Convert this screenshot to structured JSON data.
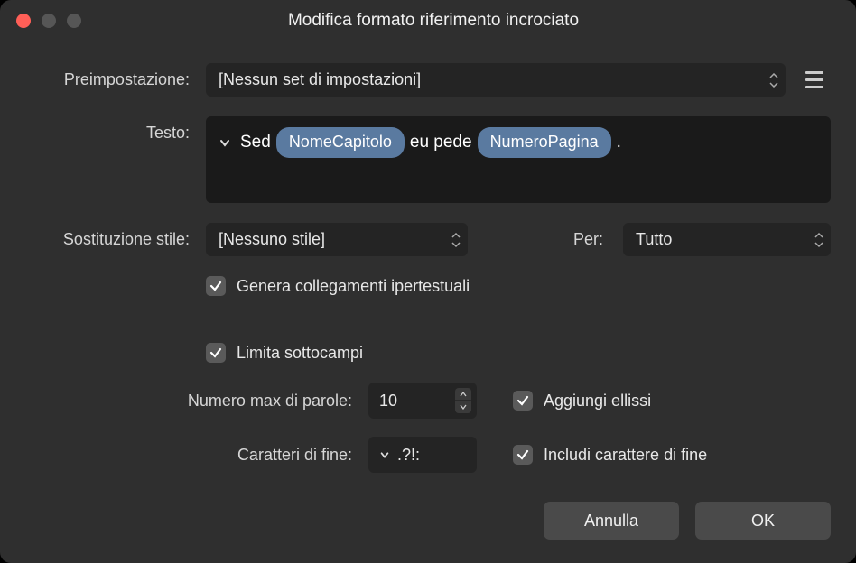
{
  "title": "Modifica formato riferimento incrociato",
  "labels": {
    "preset": "Preimpostazione:",
    "text": "Testo:",
    "style_sub": "Sostituzione stile:",
    "per": "Per:",
    "max_words": "Numero max di parole:",
    "end_chars": "Caratteri di fine:"
  },
  "preset": {
    "value": "[Nessun set di impostazioni]"
  },
  "text_template": {
    "p1": "Sed",
    "chip1": "NomeCapitolo",
    "p2": "eu pede",
    "chip2": "NumeroPagina",
    "p3": "."
  },
  "style_sub": {
    "value": "[Nessuno stile]"
  },
  "per": {
    "value": "Tutto"
  },
  "checks": {
    "gen_hyper": "Genera collegamenti ipertestuali",
    "limit_sub": "Limita sottocampi",
    "add_ellipsis": "Aggiungi ellissi",
    "include_end": "Includi carattere di fine"
  },
  "max_words": "10",
  "end_chars": ".?!:",
  "buttons": {
    "cancel": "Annulla",
    "ok": "OK"
  }
}
